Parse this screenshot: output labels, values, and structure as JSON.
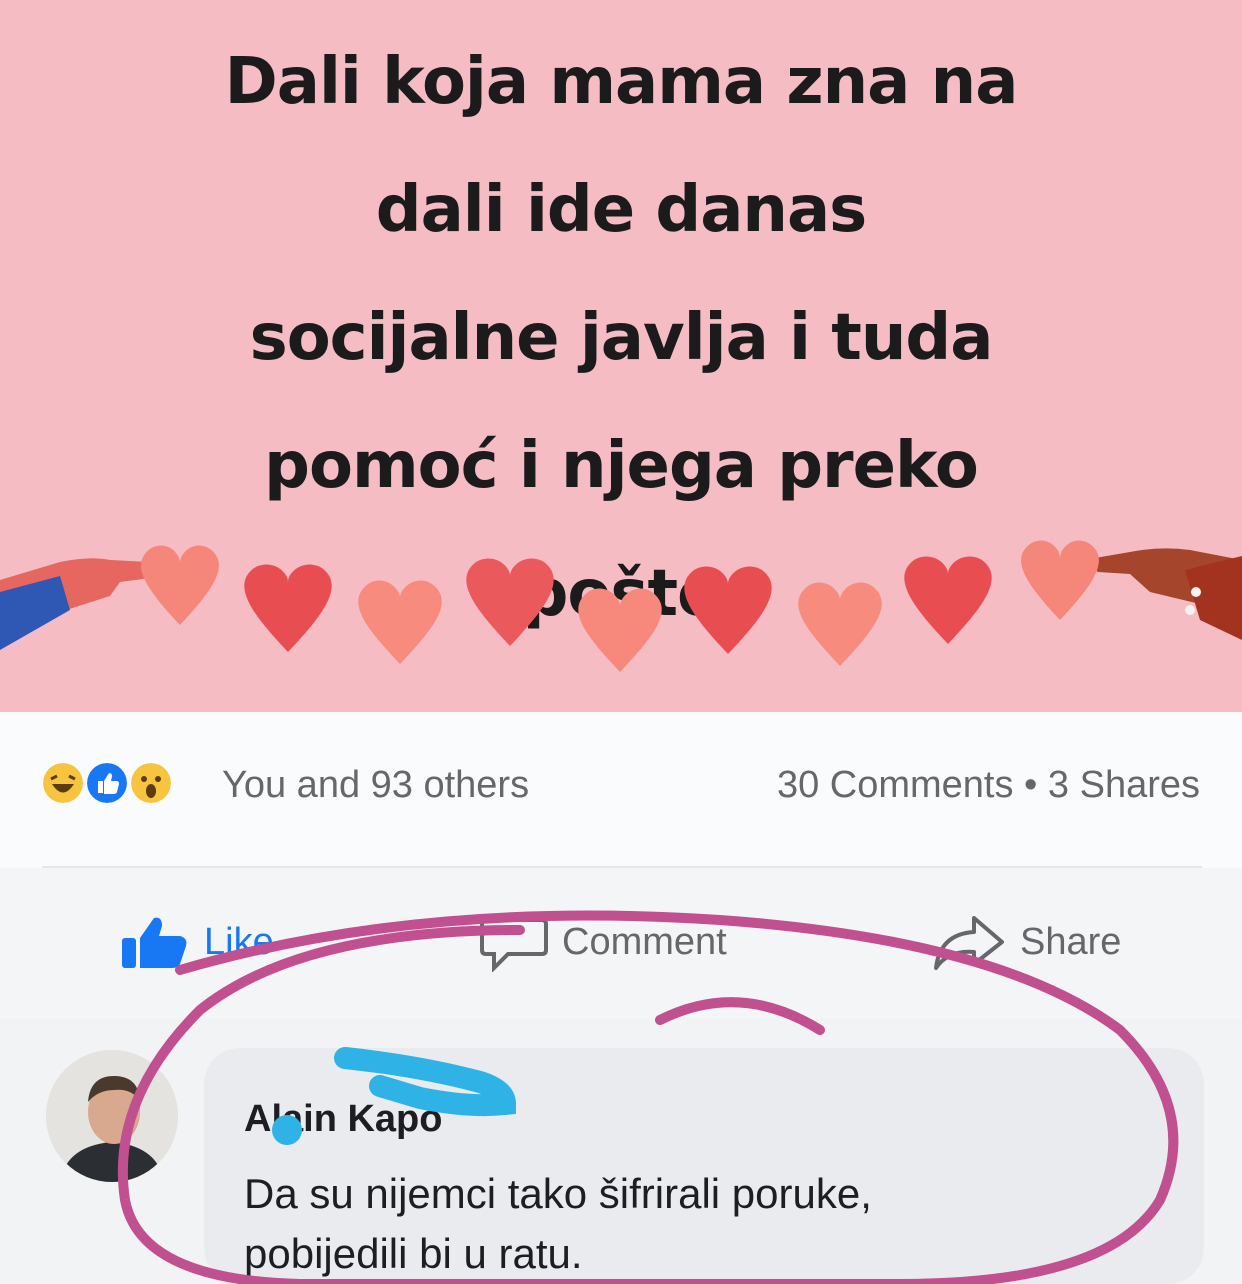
{
  "post": {
    "text_lines": [
      "Dali koja mama zna na",
      "dali ide danas",
      "socijalne javlja i tuda",
      "pomoć i njega preko",
      "pošte"
    ],
    "background_color": "#f6bcc4"
  },
  "stats": {
    "reactions": [
      "haha-icon",
      "like-icon",
      "wow-icon"
    ],
    "reactions_text": "You and 93 others",
    "comments_shares_text": "30 Comments • 3 Shares"
  },
  "actions": {
    "like_label": "Like",
    "comment_label": "Comment",
    "share_label": "Share"
  },
  "comment": {
    "author": "Alain Kapo",
    "text_line1": "Da su nijemci tako šifrirali poruke,",
    "text_line2": "pobijedili bi u ratu."
  },
  "colors": {
    "accent": "#1877f2",
    "annotation_circle": "#c0508f",
    "redaction": "#2fb3e6"
  }
}
